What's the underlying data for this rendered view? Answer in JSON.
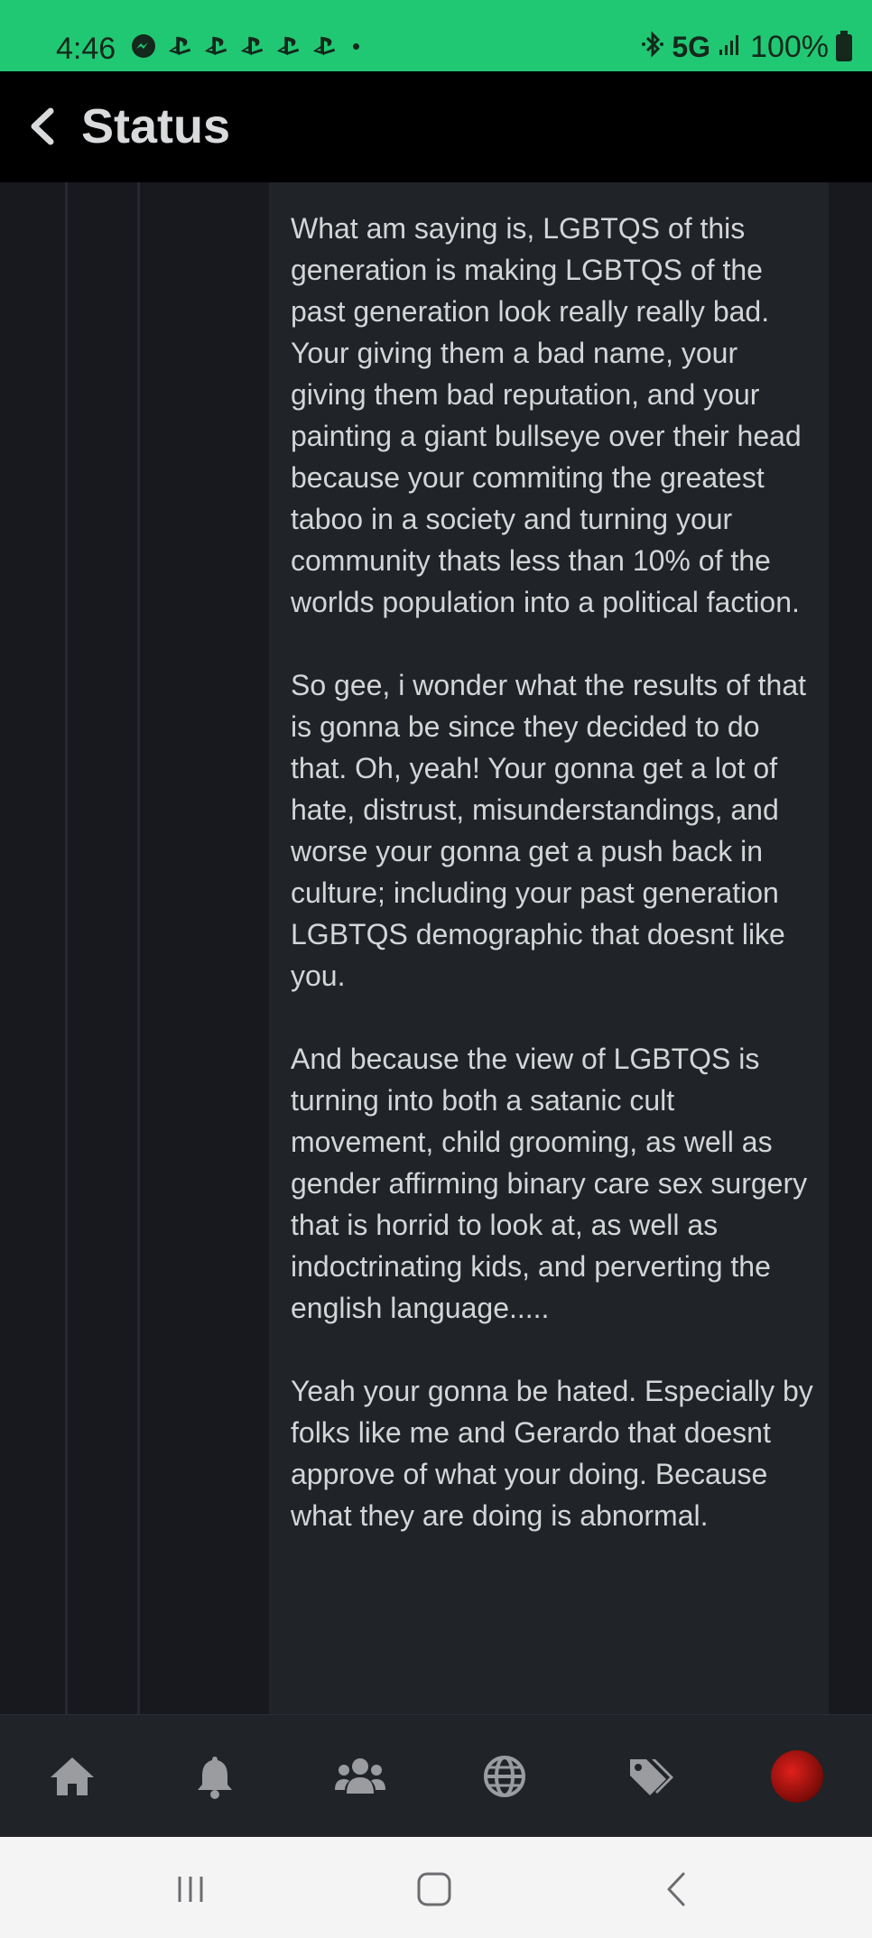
{
  "status_bar": {
    "time": "4:46",
    "network": "5G",
    "battery": "100%",
    "notification_icons": [
      "messenger-icon",
      "playstation-icon",
      "playstation-icon",
      "playstation-icon",
      "playstation-icon",
      "playstation-icon"
    ]
  },
  "header": {
    "title": "Status"
  },
  "post": {
    "paragraphs": [
      "What am saying is, LGBTQS of this generation is making LGBTQS of the past generation look really really bad. Your giving them a bad name, your giving them bad reputation, and your painting a giant bullseye over their head because your commiting the greatest taboo in a society and turning your community thats less than 10% of the worlds population into a political faction.",
      "So gee, i wonder what the results of that is gonna be since they decided to do that. Oh, yeah! Your gonna get a lot of hate, distrust, misunderstandings, and worse your gonna get a push back in culture; including your past generation LGBTQS demographic that doesnt like you.",
      "And because the view of LGBTQS is turning into both a satanic cult movement, child grooming, as well as gender affirming binary care sex surgery that is horrid to look at, as well as indoctrinating kids, and perverting the english language.....",
      "Yeah your gonna be hated. Especially by folks like me and Gerardo that doesnt approve of what your doing. Because what they are doing is abnormal."
    ]
  },
  "bottom_nav": {
    "items": [
      "home-icon",
      "bell-icon",
      "users-icon",
      "globe-icon",
      "tags-icon",
      "avatar"
    ]
  },
  "colors": {
    "status_bar": "#21c873",
    "header_bg": "#000000",
    "post_bg": "#202327",
    "text": "#d4d5d7"
  }
}
